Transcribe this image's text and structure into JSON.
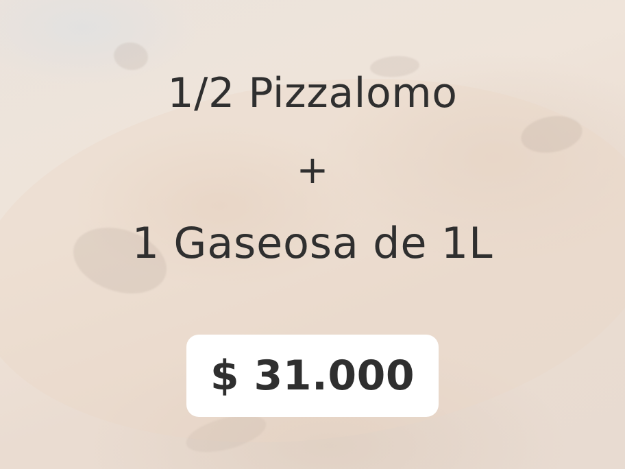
{
  "promo": {
    "line1": "1/2 Pizzalomo",
    "plus": "+",
    "line2": "1 Gaseosa de 1L",
    "price": "$ 31.000"
  }
}
